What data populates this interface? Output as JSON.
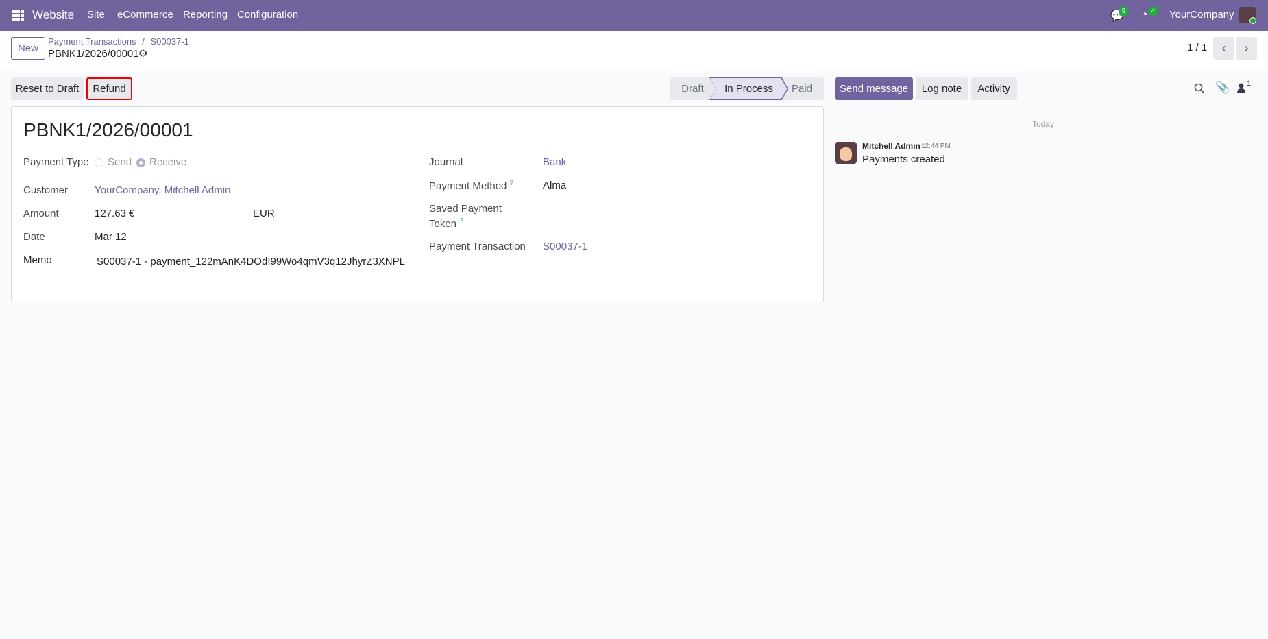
{
  "navbar": {
    "app": "Website",
    "menu": [
      "Site",
      "eCommerce",
      "Reporting",
      "Configuration"
    ],
    "messages_count": "9",
    "activities_count": "4",
    "company": "YourCompany"
  },
  "control_panel": {
    "new_label": "New",
    "breadcrumb_parent": "Payment Transactions",
    "breadcrumb_sep": "/",
    "breadcrumb_mid": "S00037-1",
    "record_name": "PBNK1/2026/00001",
    "pager": "1 / 1"
  },
  "actions": {
    "reset_label": "Reset to Draft",
    "refund_label": "Refund"
  },
  "statusbar": {
    "stages": [
      "Draft",
      "In Process",
      "Paid"
    ],
    "current": "In Process"
  },
  "form": {
    "title": "PBNK1/2026/00001",
    "payment_type": {
      "label": "Payment Type",
      "options": [
        "Send",
        "Receive"
      ],
      "selected": "Receive"
    },
    "customer": {
      "label": "Customer",
      "value": "YourCompany, Mitchell Admin"
    },
    "amount": {
      "label": "Amount",
      "value": "127.63 €",
      "currency": "EUR"
    },
    "date": {
      "label": "Date",
      "value": "Mar 12"
    },
    "memo": {
      "label": "Memo",
      "value": "S00037-1 - payment_122mAnK4DOdI99Wo4qmV3q12JhyrZ3XNPL"
    },
    "journal": {
      "label": "Journal",
      "value": "Bank"
    },
    "payment_method": {
      "label": "Payment Method",
      "help": "?",
      "value": "Alma"
    },
    "token": {
      "label1": "Saved Payment",
      "label2": "Token",
      "help": "?"
    },
    "transaction": {
      "label": "Payment Transaction",
      "value": "S00037-1"
    }
  },
  "chatter": {
    "send_label": "Send message",
    "log_label": "Log note",
    "activity_label": "Activity",
    "followers_count": "1",
    "date_sep": "Today",
    "messages": [
      {
        "author": "Mitchell Admin",
        "time": "12:44 PM",
        "body": "Payments created"
      }
    ]
  },
  "colors": {
    "brand": "#71639e",
    "badge": "#28a745"
  }
}
